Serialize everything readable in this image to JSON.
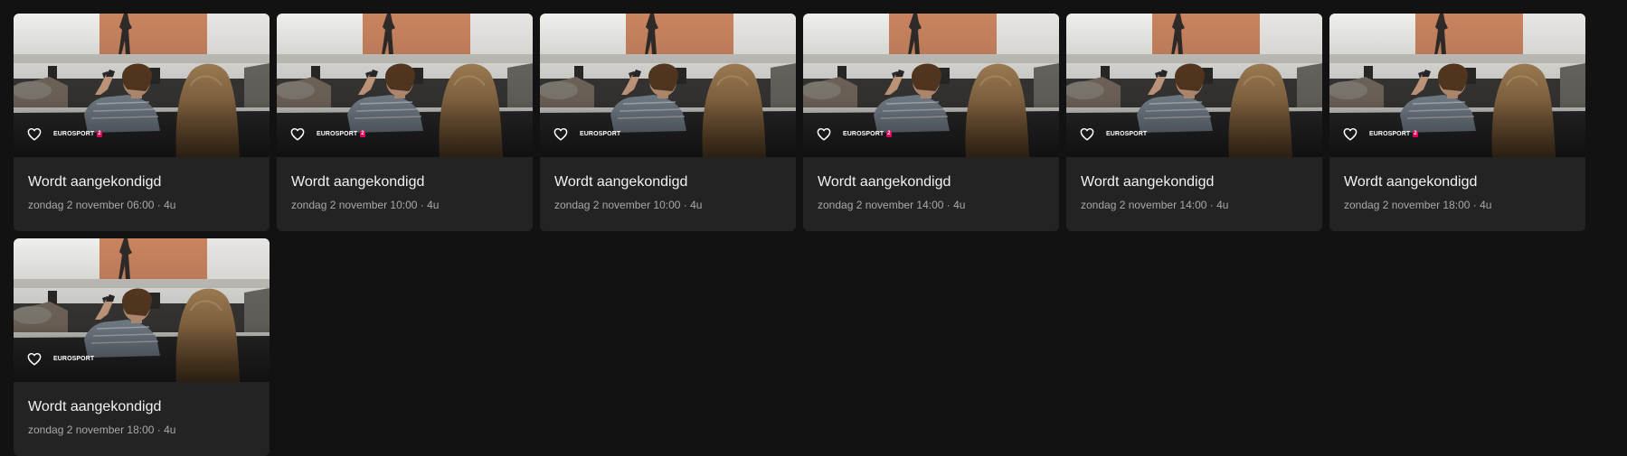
{
  "cards": [
    {
      "title": "Wordt aangekondigd",
      "meta": "zondag 2 november 06:00 · 4u",
      "channel_logo": "EUROSPORT",
      "channel_number": "2",
      "favorite_icon": "heart-outline-icon"
    },
    {
      "title": "Wordt aangekondigd",
      "meta": "zondag 2 november 10:00 · 4u",
      "channel_logo": "EUROSPORT",
      "channel_number": "2",
      "favorite_icon": "heart-outline-icon"
    },
    {
      "title": "Wordt aangekondigd",
      "meta": "zondag 2 november 10:00 · 4u",
      "channel_logo": "EUROSPORT",
      "channel_number": "",
      "favorite_icon": "heart-outline-icon"
    },
    {
      "title": "Wordt aangekondigd",
      "meta": "zondag 2 november 14:00 · 4u",
      "channel_logo": "EUROSPORT",
      "channel_number": "2",
      "favorite_icon": "heart-outline-icon"
    },
    {
      "title": "Wordt aangekondigd",
      "meta": "zondag 2 november 14:00 · 4u",
      "channel_logo": "EUROSPORT",
      "channel_number": "",
      "favorite_icon": "heart-outline-icon"
    },
    {
      "title": "Wordt aangekondigd",
      "meta": "zondag 2 november 18:00 · 4u",
      "channel_logo": "EUROSPORT",
      "channel_number": "2",
      "favorite_icon": "heart-outline-icon"
    },
    {
      "title": "Wordt aangekondigd",
      "meta": "zondag 2 november 18:00 · 4u",
      "channel_logo": "EUROSPORT",
      "channel_number": "",
      "favorite_icon": "heart-outline-icon"
    }
  ],
  "colors": {
    "page_background": "#121212",
    "card_background": "#232323",
    "title_text": "#f2f2f2",
    "meta_text": "#a9a9a9",
    "channel_badge": "#e2005a"
  }
}
